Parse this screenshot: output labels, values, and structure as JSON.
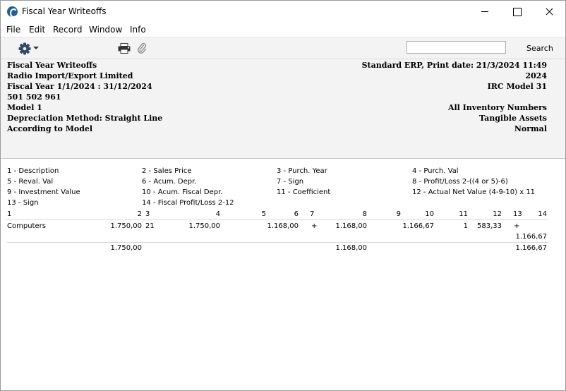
{
  "window": {
    "title": "Fiscal Year Writeoffs"
  },
  "menu": [
    "File",
    "Edit",
    "Record",
    "Window",
    "Info"
  ],
  "toolbar": {
    "search_value": "",
    "search_label": "Search"
  },
  "report_header": {
    "left": [
      "Fiscal Year Writeoffs",
      "Radio Import/Export Limited",
      "Fiscal Year 1/1/2024 : 31/12/2024",
      "501 502 961",
      "Model 1",
      "Depreciation Method: Straight Line",
      "According to Model"
    ],
    "right": [
      "Standard ERP, Print date: 21/3/2024 11:49",
      "2024",
      "IRC Model 31",
      "All Inventory Numbers",
      "Tangible Assets",
      "Normal"
    ]
  },
  "legend": [
    "1 - Description",
    "2 - Sales Price",
    "3 - Purch. Year",
    "4 - Purch. Val",
    "5 - Reval. Val",
    "6 - Acum. Depr.",
    "7 - Sign",
    "8 - Profit/Loss 2-((4 or 5)-6)",
    "9 - Investment Value",
    "10 - Acum. Fiscal Depr.",
    "11 - Coefficient",
    "12 - Actual Net Value (4-9-10) x 11",
    "13 - Sign",
    "14 - Fiscal Profit/Loss 2-12"
  ],
  "column_numbers": [
    "1",
    "2",
    "3",
    "4",
    "5",
    "6",
    "7",
    "8",
    "9",
    "10",
    "11",
    "12",
    "13",
    "14"
  ],
  "rows": [
    {
      "description": "Computers",
      "sales_price": "1.750,00",
      "purch_year": "21",
      "purch_val": "1.750,00",
      "acum_depr": "1.168,00",
      "sign": "+",
      "profit_loss": "1.168,00",
      "acum_fiscal_depr": "1.166,67",
      "coefficient": "1",
      "actual_net_value": "583,33",
      "sign2": "+",
      "fiscal_profit_loss": "1.166,67"
    }
  ],
  "totals": {
    "sales_price": "1.750,00",
    "profit_loss": "1.168,00",
    "fiscal_profit_loss": "1.166,67"
  }
}
